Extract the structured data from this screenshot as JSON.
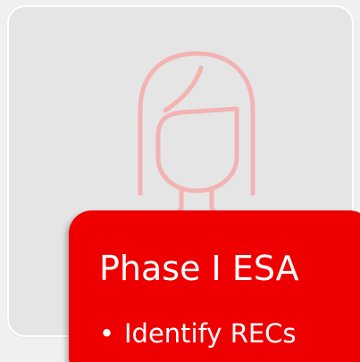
{
  "slide": {
    "callout_title": "Phase I ESA",
    "bullets": [
      {
        "marker": "•",
        "text": "Identify RECs"
      }
    ]
  },
  "icons": {
    "person": "female-user-outline-icon"
  },
  "colors": {
    "background": "#f0f0f0",
    "card": "#e5e5e5",
    "card_border": "#ffffff",
    "callout": "#ee0000",
    "callout_text": "#ffffff",
    "icon_stroke": "#f3b3b3"
  }
}
